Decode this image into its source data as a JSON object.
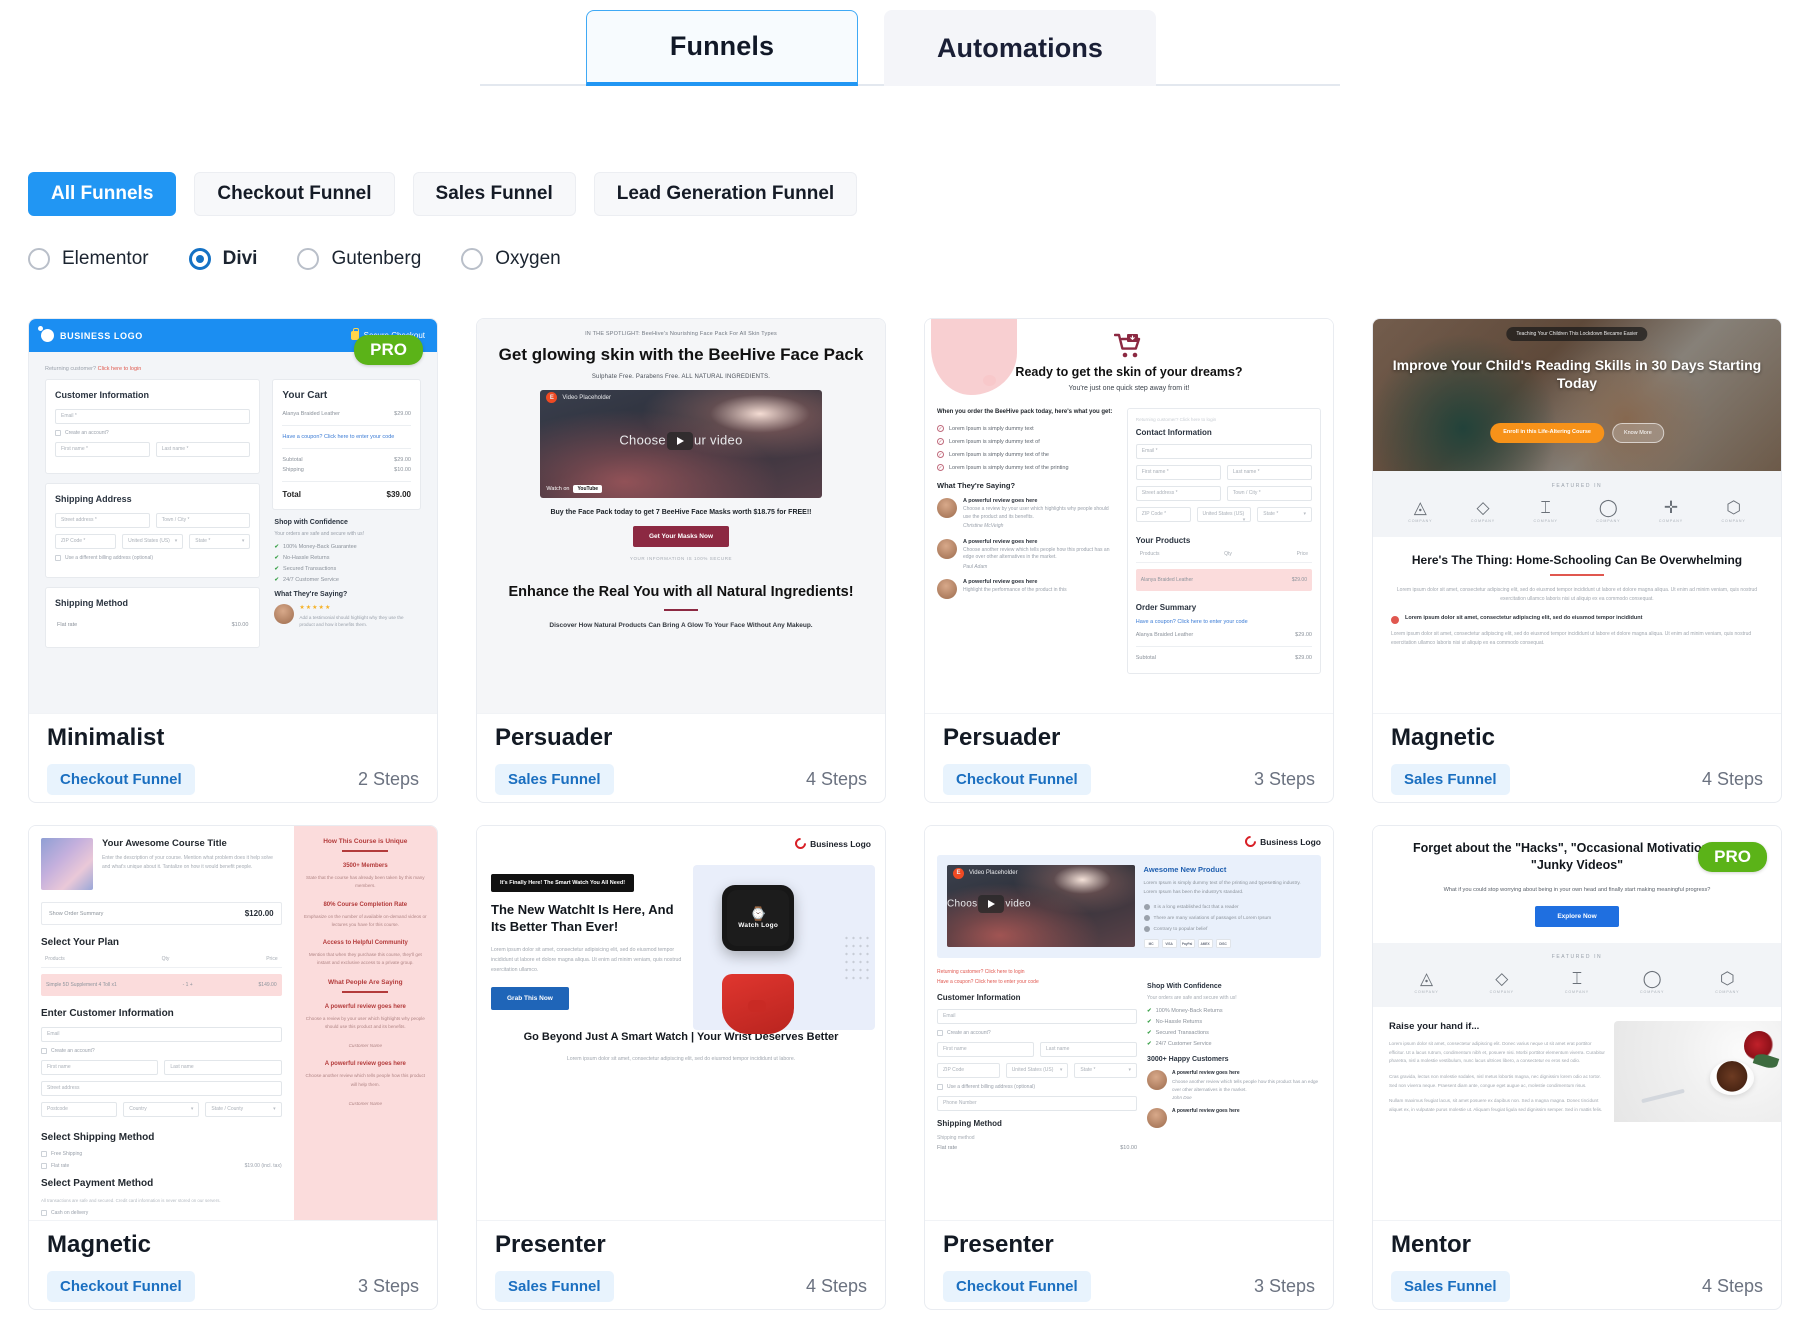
{
  "tabs": [
    {
      "label": "Funnels",
      "active": true
    },
    {
      "label": "Automations",
      "active": false
    }
  ],
  "filters": [
    {
      "label": "All Funnels",
      "active": true
    },
    {
      "label": "Checkout Funnel",
      "active": false
    },
    {
      "label": "Sales Funnel",
      "active": false
    },
    {
      "label": "Lead Generation Funnel",
      "active": false
    }
  ],
  "builders": [
    {
      "label": "Elementor",
      "checked": false
    },
    {
      "label": "Divi",
      "checked": true
    },
    {
      "label": "Gutenberg",
      "checked": false
    },
    {
      "label": "Oxygen",
      "checked": false
    }
  ],
  "colors": {
    "accent": "#2196f3",
    "pro_badge": "#5bb318",
    "badge_bg": "#e8f3fd",
    "badge_text": "#1b6fc0"
  },
  "cards": [
    {
      "title": "Minimalist",
      "type": "Checkout Funnel",
      "steps": "2 Steps",
      "pro": "PRO",
      "preview": {
        "logo": "BUSINESS LOGO",
        "secure": "Secure Checkout",
        "returning": "Returning customer?",
        "returning_link": "Click here to login",
        "customer_information": "Customer Information",
        "email": "Email *",
        "create_account": "Create an account?",
        "first_name": "First name *",
        "last_name": "Last name *",
        "shipping_address": "Shipping Address",
        "street": "Street address *",
        "town": "Town / City *",
        "zip": "ZIP Code *",
        "country_label": "Country *",
        "country_value": "United States (US)",
        "state": "State *",
        "billing": "Use a different billing address (optional)",
        "shipping_method": "Shipping Method",
        "flat_rate": "Flat rate",
        "flat_rate_price": "$10.00",
        "cart_title": "Your Cart",
        "cart_item": "Alanya Braided Leather",
        "cart_item_price": "$29.00",
        "coupon": "Have a coupon? Click here to enter your code",
        "subtotal_label": "Subtotal",
        "subtotal_value": "$29.00",
        "shipping_label": "Shipping",
        "shipping_value": "$10.00",
        "total_label": "Total",
        "total_value": "$39.00",
        "confidence_title": "Shop with Confidence",
        "confidence_sub": "Your orders are safe and secure with us!",
        "trust": [
          "100% Money-Back Guarantee",
          "No-Hassle Returns",
          "Secured Transactions",
          "24/7 Customer Service"
        ],
        "saying_title": "What They're Saying?",
        "testimonial": "Add a testimonial should highlight why they use the product and how it benefits them."
      }
    },
    {
      "title": "Persuader",
      "type": "Sales Funnel",
      "steps": "4 Steps",
      "pro": "",
      "preview": {
        "eyebrow": "IN THE SPOTLIGHT: BeeHive's Nourishing Face Pack For All Skin Types",
        "headline": "Get glowing skin with the BeeHive Face Pack",
        "subhead": "Sulphate Free. Parabens Free. ALL NATURAL INGREDIENTS.",
        "video_label": "Video Placeholder",
        "video_cta": "Choose your video",
        "video_watch": "Watch on",
        "video_brand": "YouTube",
        "buy_line": "Buy the Face Pack today to get 7 BeeHive Face Masks worth $18.75 for FREE!!",
        "button": "Get Your Masks Now",
        "secure_note": "YOUR INFORMATION IS 100% SECURE",
        "headline2": "Enhance the Real You with all Natural Ingredients!",
        "subhead2": "Discover How Natural Products Can Bring A Glow To Your Face Without Any Makeup."
      }
    },
    {
      "title": "Persuader",
      "type": "Checkout Funnel",
      "steps": "3 Steps",
      "pro": "",
      "preview": {
        "headline": "Ready to get the skin of your dreams?",
        "subhead": "You're just one quick step away from it!",
        "lead": "When you order the BeeHive pack today, here's what you get:",
        "bullets": [
          "Lorem Ipsum is simply dummy text",
          "Lorem Ipsum is simply dummy text of",
          "Lorem Ipsum is simply dummy text of the",
          "Lorem Ipsum is simply dummy text of the printing"
        ],
        "saying_title": "What They're Saying?",
        "reviews": [
          {
            "title": "A powerful review goes here",
            "body": "Choose a review by your user which highlights why people should use the product and its benefits.",
            "author": "Christine McVeigh"
          },
          {
            "title": "A powerful review goes here",
            "body": "Choose another review which tells people how this product has an edge over other alternatives in the market.",
            "author": "Paul Adam"
          },
          {
            "title": "A powerful review goes here",
            "body": "Highlight the performance of the product in this",
            "author": ""
          }
        ],
        "returning": "Returning customer? Click here to login",
        "contact_information": "Contact Information",
        "email": "Email *",
        "first_name": "First name *",
        "last_name": "Last name *",
        "street": "Street address *",
        "town": "Town / City *",
        "zip": "ZIP Code *",
        "country_label": "Country *",
        "country_value": "United States (US)",
        "state": "State *",
        "products_title": "Your Products",
        "col_products": "Products",
        "col_qty": "Qty",
        "col_price": "Price",
        "product_row": "Alanya Braided Leather",
        "product_price": "$29.00",
        "order_summary": "Order Summary",
        "coupon": "Have a coupon? Click here to enter your code",
        "summary_item": "Alanya Braided Leather",
        "summary_price": "$29.00",
        "subtotal_label": "Subtotal",
        "subtotal_value": "$29.00"
      }
    },
    {
      "title": "Magnetic",
      "type": "Sales Funnel",
      "steps": "4 Steps",
      "pro": "",
      "preview": {
        "tag": "Teaching Your Children This Lockdown Became Easier",
        "headline": "Improve Your Child's Reading Skills in 30 Days Starting Today",
        "button_primary": "Enroll in this Life-Altering Course",
        "button_secondary": "Know More",
        "featured_label": "FEATURED IN",
        "featured_logos": [
          "COMPANY",
          "COMPANY",
          "COMPANY",
          "COMPANY",
          "COMPANY",
          "COMPANY"
        ],
        "headline2": "Here's The Thing: Home-Schooling Can Be Overwhelming",
        "body": "Lorem ipsum dolor sit amet, consectetur adipiscing elit, sed do eiusmod tempor incididunt ut labore et dolore magna aliqua. Ut enim ad minim veniam, quis nostrud exercitation ullamco laboris nisi ut aliquip ex ea commodo consequat.",
        "bullet": "Lorem ipsum dolor sit amet, consectetur adipiscing elit, sed do eiusmod tempor incididunt"
      }
    },
    {
      "title": "Magnetic",
      "type": "Checkout Funnel",
      "steps": "3 Steps",
      "pro": "",
      "preview": {
        "course_title": "Your Awesome Course Title",
        "course_desc": "Enter the description of your course. Mention what problem does it help solve and what's unique about it. Tantalize on how it would benefit people.",
        "order_summary": "Show Order Summary",
        "order_total": "$120.00",
        "select_plan": "Select Your Plan",
        "col_products": "Products",
        "col_qty": "Qty",
        "col_price": "Price",
        "plan_row": "Simple 5D Supplement 4 Toll x1",
        "plan_price": "$149.00",
        "customer_information": "Enter Customer Information",
        "email": "Email",
        "create_account": "Create an account?",
        "first_name": "First name",
        "last_name": "Last name",
        "street_address": "Street address",
        "postcode": "Postcode",
        "country": "Country",
        "state": "State / County",
        "select_shipping": "Select Shipping Method",
        "free_shipping": "Free Shipping",
        "flat_rate": "Flat rate",
        "flat_rate_price": "$19.00 (incl. tax)",
        "select_payment": "Select Payment Method",
        "payment_note": "All transactions are safe and secured. Credit card information is never stored on our servers.",
        "cash": "Cash on delivery",
        "right_title": "How This Course is Unique",
        "right_items": [
          {
            "title": "3500+ Members",
            "body": "State that the course has already been taken by this many members."
          },
          {
            "title": "80% Course Completion Rate",
            "body": "Emphasize on the number of available on-demand videos or lectures you have for this course."
          },
          {
            "title": "Access to Helpful Community",
            "body": "Mention that when they purchase this course, they'll get instant and exclusive access to a private group."
          }
        ],
        "saying_title": "What People Are Saying",
        "reviews": [
          {
            "title": "A powerful review goes here",
            "body": "Choose a review by your user which highlights why people should use this product and its benefits.",
            "author": "Customer Name"
          },
          {
            "title": "A powerful review goes here",
            "body": "Choose another review which tells people how this product will help them.",
            "author": "Customer Name"
          }
        ]
      }
    },
    {
      "title": "Presenter",
      "type": "Sales Funnel",
      "steps": "4 Steps",
      "pro": "",
      "preview": {
        "logo": "Business Logo",
        "tag": "It's Finally Here! The Smart Watch You All Need!",
        "headline": "The New WatchIt Is Here, And Its Better Than Ever!",
        "body": "Lorem ipsum dolor sit amet, consectetur adipisicing elit, sed do eiusmod tempor incididunt ut labore et dolore magna aliqua. Ut enim ad minim veniam, quis nostrud exercitation ullamco.",
        "button": "Grab This Now",
        "watch_label": "Watch Logo",
        "headline2": "Go Beyond Just A Smart Watch | Your Wrist Deserves Better",
        "body2": "Lorem ipsum dolor sit amet, consectetur adipiscing elit, sed do eiusmod tempor incididunt ut labore."
      }
    },
    {
      "title": "Presenter",
      "type": "Checkout Funnel",
      "steps": "3 Steps",
      "pro": "",
      "preview": {
        "logo": "Business Logo",
        "video_label": "Video Placeholder",
        "video_cta": "Choose your video",
        "product_title": "Awesome New Product",
        "product_body": "Lorem Ipsum is simply dummy text of the printing and typesetting industry. Lorem Ipsum has been the industry's standard.",
        "bullets": [
          "It is a long established fact that a reader",
          "There are many variations of passages of Lorem Ipsum",
          "Contrary to popular belief"
        ],
        "payments": [
          "MC",
          "VISA",
          "PayPal",
          "AMEX",
          "DISC"
        ],
        "returning": "Returning customer? Click here to login",
        "coupon": "Have a coupon? Click here to enter your code",
        "customer_information": "Customer Information",
        "email": "Email",
        "create_account": "Create an account?",
        "first_name": "First name",
        "last_name": "Last name",
        "zip": "ZIP Code",
        "country_label": "Country *",
        "country_value": "United States (US)",
        "state": "State *",
        "billing": "Use a different billing address (optional)",
        "phone": "Phone Number",
        "shipping_method": "Shipping Method",
        "shipping_label": "Shipping method",
        "flat_rate": "Flat rate",
        "flat_rate_price": "$10.00",
        "confidence_title": "Shop With Confidence",
        "confidence_sub": "Your orders are safe and secure with us!",
        "trust": [
          "100% Money-Back Returns",
          "No-Hassle Returns",
          "Secured Transactions",
          "24/7 Customer Service"
        ],
        "happy": "3000+ Happy Customers",
        "review_title": "A powerful review goes here",
        "review_body": "Choose another review which tells people how this product has an edge over other alternatives in the market.",
        "review_author": "John Doe"
      }
    },
    {
      "title": "Mentor",
      "type": "Sales Funnel",
      "steps": "4 Steps",
      "pro": "PRO",
      "preview": {
        "headline": "Forget about the \"Hacks\", \"Occasional Motivation\" and \"Junky Videos\"",
        "subhead": "What if you could stop worrying about being in your own head and finally start making meaningful progress?",
        "button": "Explore Now",
        "featured_label": "FEATURED IN",
        "featured_logos": [
          "COMPANY",
          "COMPANY",
          "COMPANY",
          "COMPANY",
          "COMPANY"
        ],
        "headline2": "Raise your hand if...",
        "body1": "Lorem ipsum dolor sit amet, consectetur adipiscing elit. Donec varius neque ut sit amet erat porttitor efficitur. Ut a lacus rutrum, condimentum nibh et, posuere nisi. Morbi porttitor elementum viverra. Curabitur pharetra, nisl a molestie vestibulum, nunc lacus ultrices libero, a consectetur ex eros sed odio.",
        "body2": "Cras gravida, lectus non molestie sodales, nisl metus lobortis magna, nec dignissim lorem odio ac tortor. Sed non viverra neque. Praesent diam ante, congue eget augue ac, molestie condimentum risus.",
        "body3": "Nullam maximus feugiat lacus, sit amet posuere ex dapibus non. Sed a magna magna. Donec tincidunt aliquet ex, in vulputate purus molestie ut. Aliquam feugiat ligula sed dignissim semper. Sed in mattis felis."
      }
    }
  ]
}
